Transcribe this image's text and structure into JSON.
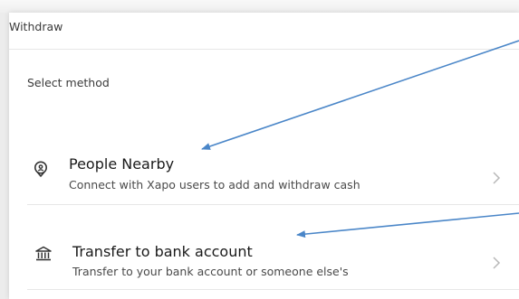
{
  "page": {
    "title": "Withdraw",
    "section_label": "Select method"
  },
  "methods": [
    {
      "title": "People Nearby",
      "subtitle": "Connect with Xapo users to add and withdraw cash",
      "icon": "location-pin-icon"
    },
    {
      "title": "Transfer to bank account",
      "subtitle": "Transfer to your bank account or someone else's",
      "icon": "bank-icon"
    }
  ],
  "colors": {
    "annotation_arrow": "#4a86c8",
    "card_background": "#ffffff",
    "page_background": "#ececec",
    "divider": "#e7e7e7",
    "chevron": "#b8b8b8"
  }
}
